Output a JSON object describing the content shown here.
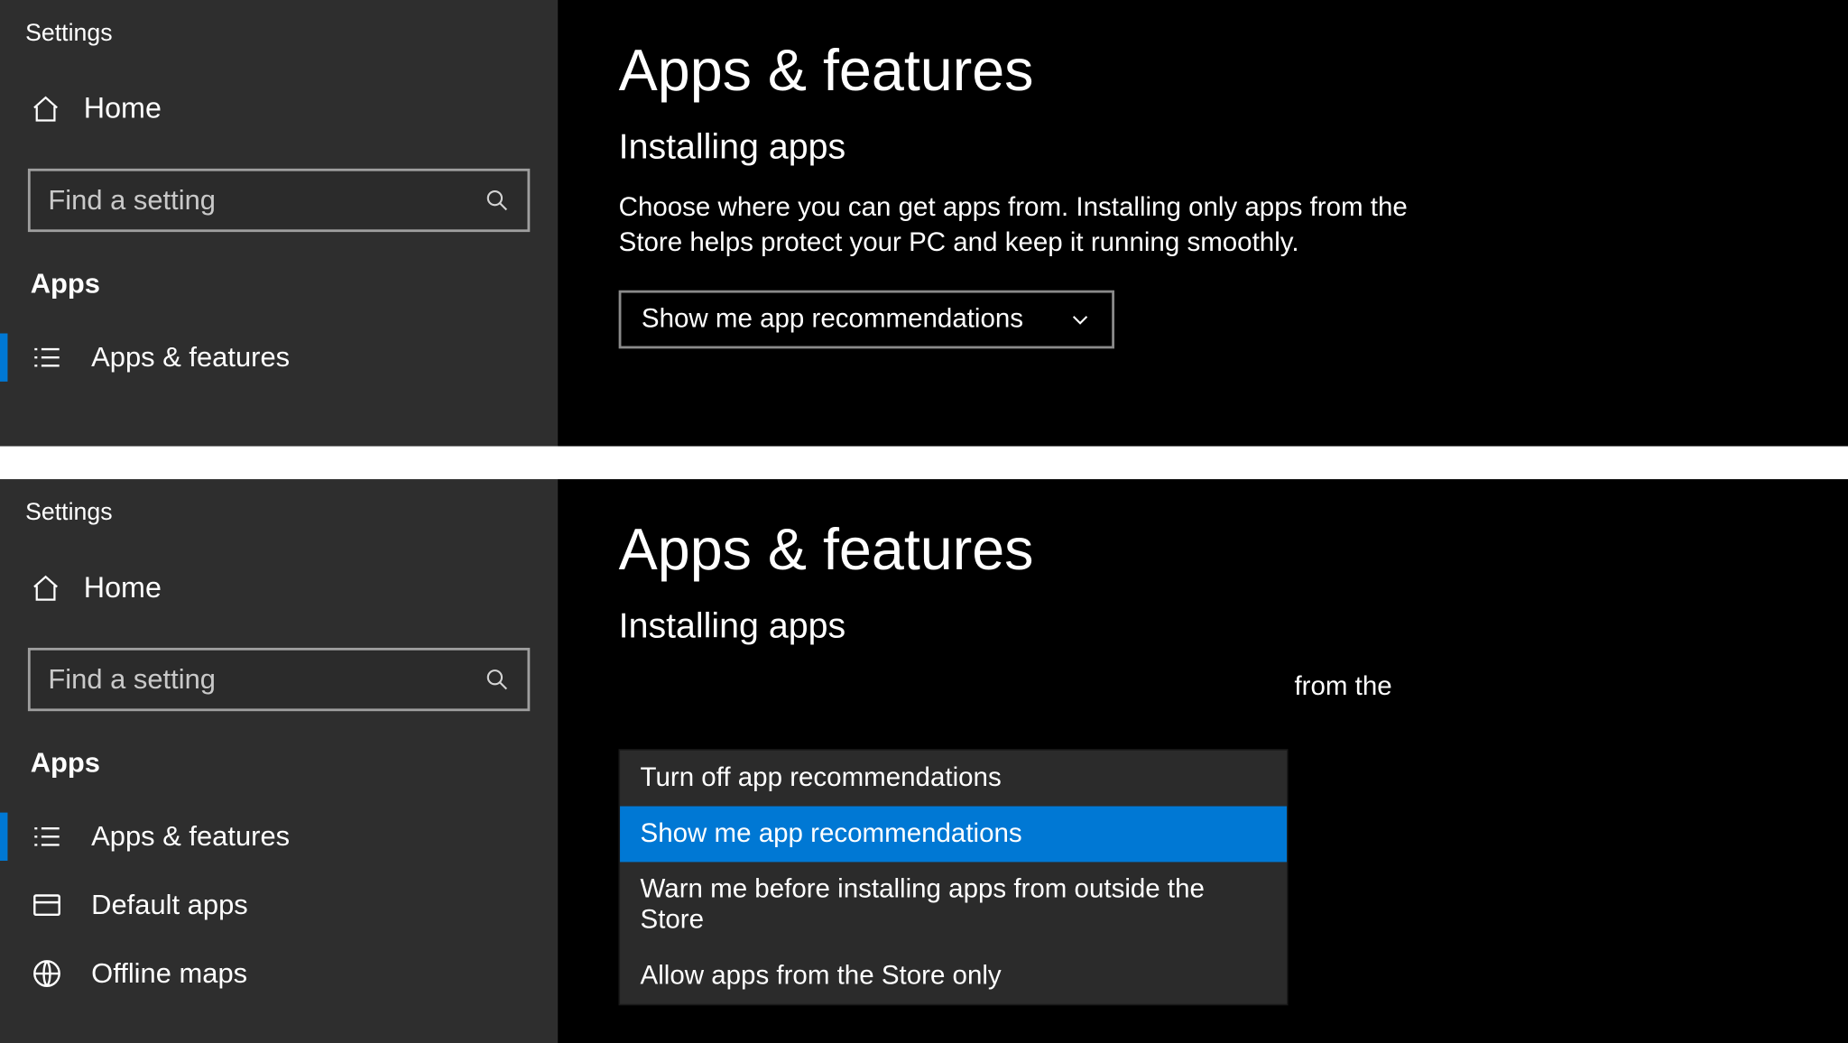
{
  "top": {
    "sidebar": {
      "title": "Settings",
      "home_label": "Home",
      "search_placeholder": "Find a setting",
      "section_label": "Apps",
      "items": [
        {
          "label": "Apps & features",
          "icon": "apps-features-icon",
          "selected": true
        }
      ]
    },
    "main": {
      "page_title": "Apps & features",
      "subhead": "Installing apps",
      "description": "Choose where you can get apps from. Installing only apps from the Store helps protect your PC and keep it running smoothly.",
      "dropdown_value": "Show me app recommendations"
    }
  },
  "bottom": {
    "sidebar": {
      "title": "Settings",
      "home_label": "Home",
      "search_placeholder": "Find a setting",
      "section_label": "Apps",
      "items": [
        {
          "label": "Apps & features",
          "icon": "apps-features-icon",
          "selected": true
        },
        {
          "label": "Default apps",
          "icon": "default-apps-icon",
          "selected": false
        },
        {
          "label": "Offline maps",
          "icon": "offline-maps-icon",
          "selected": false
        }
      ]
    },
    "main": {
      "page_title": "Apps & features",
      "subhead": "Installing apps",
      "description_fragment": "from the",
      "dropdown_options": [
        {
          "label": "Turn off app recommendations",
          "selected": false
        },
        {
          "label": "Show me app recommendations",
          "selected": true
        },
        {
          "label": "Warn me before installing apps from outside the Store",
          "selected": false
        },
        {
          "label": "Allow apps from the Store only",
          "selected": false
        }
      ]
    }
  }
}
